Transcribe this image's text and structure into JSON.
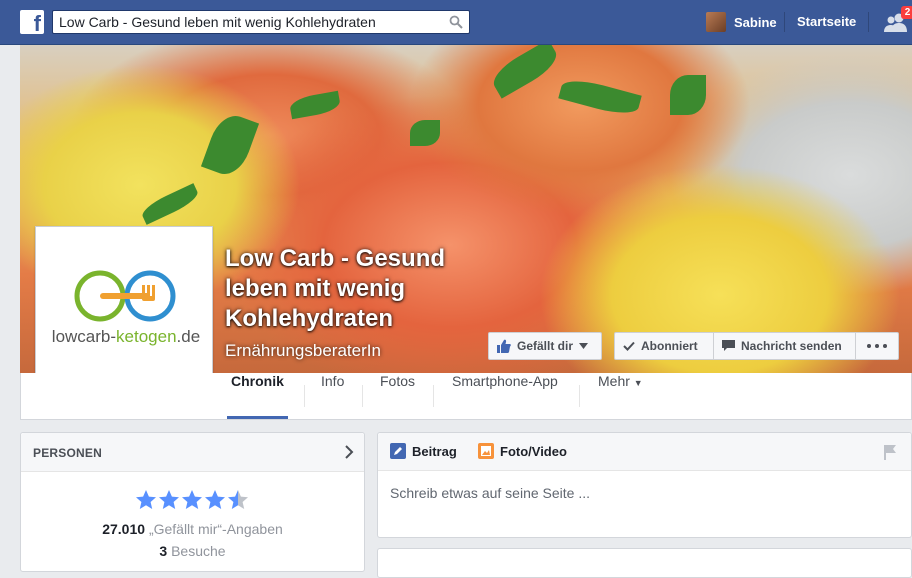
{
  "topbar": {
    "search_value": "Low Carb - Gesund leben mit wenig Kohlehydraten",
    "user_name": "Sabine",
    "home_label": "Startseite",
    "friend_requests_badge": "2",
    "icons": [
      "facebook-logo-icon",
      "search-icon",
      "friends-icon"
    ],
    "brand_color": "#3b5998"
  },
  "page": {
    "title": "Low Carb - Gesund leben mit wenig Kohlehydraten",
    "category": "ErnährungsberaterIn",
    "logo_text_main": "lowcarb-",
    "logo_text_accent": "ketogen",
    "logo_text_end": ".de"
  },
  "actions": {
    "like_label": "Gefällt dir",
    "subscribed_label": "Abonniert",
    "message_label": "Nachricht senden"
  },
  "nav": {
    "tabs": [
      "Chronik",
      "Info",
      "Fotos",
      "Smartphone-App",
      "Mehr"
    ],
    "active_tab": "Chronik"
  },
  "people_card": {
    "title": "PERSONEN",
    "rating": 4.5,
    "likes_count": "27.010",
    "likes_label": "„Gefällt mir“-Angaben",
    "visits_count": "3",
    "visits_label": "Besuche"
  },
  "composer": {
    "post_tab": "Beitrag",
    "photo_tab": "Foto/Video",
    "placeholder": "Schreib etwas auf seine Seite ..."
  }
}
